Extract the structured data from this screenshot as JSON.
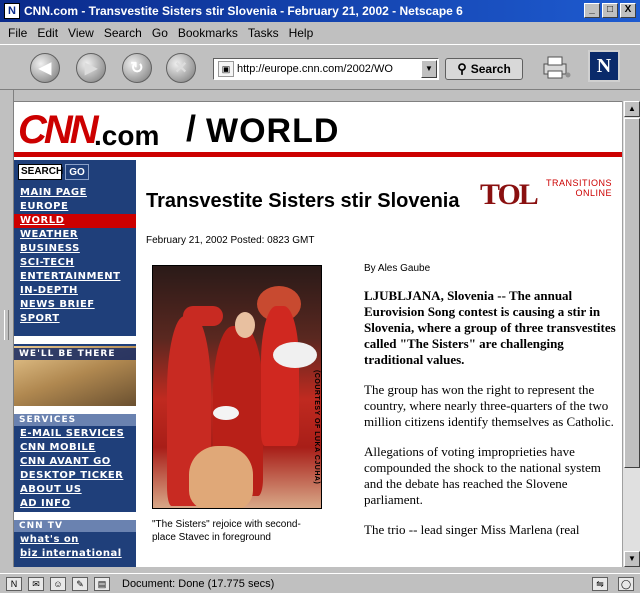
{
  "window": {
    "title": "CNN.com - Transvestite Sisters stir Slovenia - February 21, 2002 - Netscape 6",
    "app_logo": "N",
    "buttons": [
      "_",
      "□",
      "X"
    ]
  },
  "menu": [
    {
      "label": "File"
    },
    {
      "label": "Edit"
    },
    {
      "label": "View"
    },
    {
      "label": "Search"
    },
    {
      "label": "Go"
    },
    {
      "label": "Bookmarks"
    },
    {
      "label": "Tasks"
    },
    {
      "label": "Help"
    }
  ],
  "toolbar": {
    "back_icon": "back-arrow-icon",
    "forward_icon": "forward-arrow-icon",
    "reload_icon": "reload-icon",
    "stop_icon": "stop-icon",
    "url": "http://europe.cnn.com/2002/WO",
    "search_label": "Search",
    "brand": "N"
  },
  "header": {
    "logo": "CNN",
    "dotcom": ".com",
    "slash": "/",
    "section": "WORLD"
  },
  "nav": {
    "search_text": "SEARCH",
    "go_label": "GO",
    "items": [
      {
        "label": "MAIN PAGE",
        "active": false
      },
      {
        "label": "EUROPE",
        "active": false
      },
      {
        "label": "WORLD",
        "active": true
      },
      {
        "label": "WEATHER",
        "active": false
      },
      {
        "label": "BUSINESS",
        "active": false
      },
      {
        "label": "SCI-TECH",
        "active": false
      },
      {
        "label": "ENTERTAINMENT",
        "active": false
      },
      {
        "label": "IN-DEPTH",
        "active": false
      },
      {
        "label": "NEWS BRIEF",
        "active": false
      },
      {
        "label": "SPORT",
        "active": false
      }
    ],
    "promo_label": "WE'LL BE THERE",
    "services_head": "SERVICES",
    "services": [
      {
        "label": "E-MAIL SERVICES"
      },
      {
        "label": "CNN MOBILE"
      },
      {
        "label": "CNN AVANT GO"
      },
      {
        "label": "DESKTOP TICKER"
      },
      {
        "label": "ABOUT US"
      },
      {
        "label": "AD INFO"
      }
    ],
    "tv_head": "CNN TV",
    "tv_items": [
      {
        "label": "what's on"
      },
      {
        "label": "biz international"
      }
    ]
  },
  "article": {
    "headline": "Transvestite Sisters stir Slovenia",
    "partner_logo": "TOL",
    "partner_name_1": "TRANSITIONS",
    "partner_name_2": "ONLINE",
    "dateline": "February 21, 2002 Posted: 0823 GMT",
    "photo_credit": "(COURTESY OF LUKA CJUHA)",
    "caption": "\"The Sisters\" rejoice with second-place Stavec in foreground",
    "byline": "By Ales Gaube",
    "paragraphs": [
      "LJUBLJANA, Slovenia -- The annual Eurovision Song contest is causing a stir in Slovenia, where a group of three transvestites called \"The Sisters\" are challenging traditional values.",
      "The group has won the right to represent the country, where nearly three-quarters of the two million citizens identify themselves as Catholic.",
      "Allegations of voting improprieties have compounded the shock to the national system and the debate has reached the Slovene parliament.",
      "The trio -- lead singer Miss Marlena (real"
    ]
  },
  "status": {
    "text": "Document: Done (17.775 secs)"
  },
  "colors": {
    "cnn_red": "#cc0000",
    "nav_blue": "#1f3f7a",
    "title_blue": "#0a2a8a"
  }
}
